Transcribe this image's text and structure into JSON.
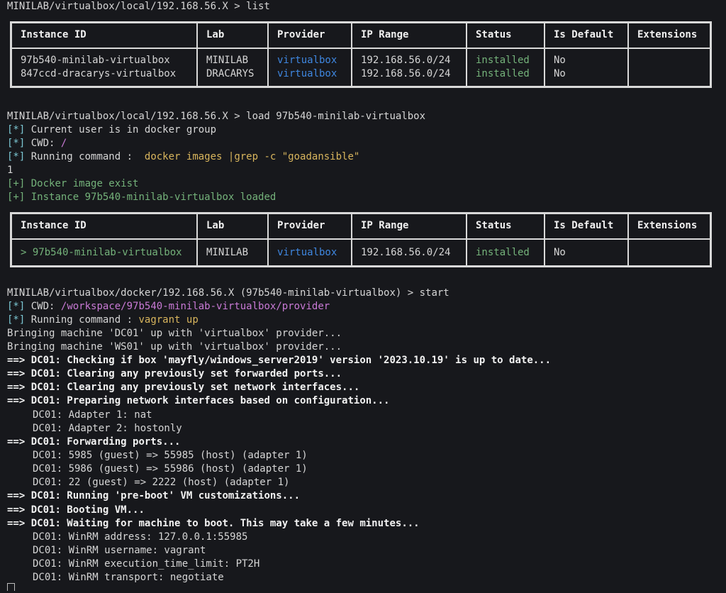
{
  "colors": {
    "background": "#17181c",
    "cyan": "#7cc7d3",
    "green": "#74b27a",
    "yellow": "#d8b55d",
    "magenta": "#c97ad6",
    "blue": "#3f87e0"
  },
  "block1": {
    "prompt": "MINILAB/virtualbox/local/192.168.56.X > list",
    "headers": [
      "Instance ID",
      "Lab",
      "Provider",
      "IP Range",
      "Status",
      "Is Default",
      "Extensions"
    ],
    "ids": "97b540-minilab-virtualbox\n847ccd-dracarys-virtualbox",
    "labs": "MINILAB\nDRACARYS",
    "providers": "virtualbox\nvirtualbox",
    "ranges": "192.168.56.0/24\n192.168.56.0/24",
    "statuses": "installed\ninstalled",
    "defaults": "No\nNo",
    "extensions": ""
  },
  "block2": {
    "prompt": "MINILAB/virtualbox/local/192.168.56.X > load 97b540-minilab-virtualbox",
    "marker_info": "[*]",
    "marker_ok": "[+]",
    "l1": "Current user is in docker group",
    "l2_label": "CWD:",
    "l2_value": "/",
    "l3_label": "Running command :",
    "l3_value": "docker images |grep -c \"goadansible\"",
    "l4": "1",
    "l5": "Docker image exist",
    "l6": "Instance 97b540-minilab-virtualbox loaded",
    "headers": [
      "Instance ID",
      "Lab",
      "Provider",
      "IP Range",
      "Status",
      "Is Default",
      "Extensions"
    ],
    "row": {
      "id": "> 97b540-minilab-virtualbox",
      "lab": "MINILAB",
      "provider": "virtualbox",
      "range": "192.168.56.0/24",
      "status": "installed",
      "default": "No",
      "extensions": ""
    }
  },
  "block3": {
    "prompt": "MINILAB/virtualbox/docker/192.168.56.X (97b540-minilab-virtualbox) > start",
    "cwd_label": "CWD:",
    "cwd_value": "/workspace/97b540-minilab-virtualbox/provider",
    "cmd_label": "Running command :",
    "cmd_value": "vagrant up",
    "arrow": "==>",
    "lines": [
      "Bringing machine 'DC01' up with 'virtualbox' provider...",
      "Bringing machine 'WS01' up with 'virtualbox' provider...",
      "DC01: Checking if box 'mayfly/windows_server2019' version '2023.10.19' is up to date...",
      "DC01: Clearing any previously set forwarded ports...",
      "DC01: Clearing any previously set network interfaces...",
      "DC01: Preparing network interfaces based on configuration...",
      "DC01: Adapter 1: nat",
      "DC01: Adapter 2: hostonly",
      "DC01: Forwarding ports...",
      "DC01: 5985 (guest) => 55985 (host) (adapter 1)",
      "DC01: 5986 (guest) => 55986 (host) (adapter 1)",
      "DC01: 22 (guest) => 2222 (host) (adapter 1)",
      "DC01: Running 'pre-boot' VM customizations...",
      "DC01: Booting VM...",
      "DC01: Waiting for machine to boot. This may take a few minutes...",
      "DC01: WinRM address: 127.0.0.1:55985",
      "DC01: WinRM username: vagrant",
      "DC01: WinRM execution_time_limit: PT2H",
      "DC01: WinRM transport: negotiate"
    ]
  }
}
